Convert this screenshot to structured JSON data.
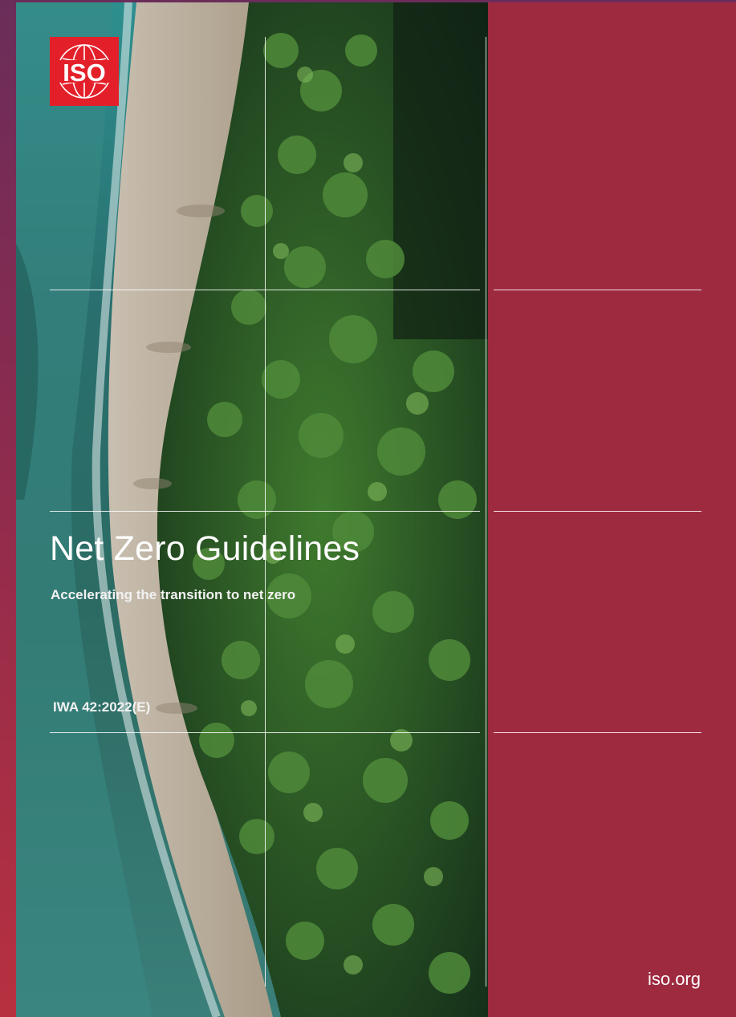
{
  "cover": {
    "logo_text": "ISO",
    "title": "Net Zero Guidelines",
    "subtitle": "Accelerating the transition to net zero",
    "document_number": "IWA 42:2022(E)",
    "website": "iso.org"
  },
  "colors": {
    "panel": "#9e2a40",
    "logo_red": "#e3202a",
    "text": "#ffffff"
  },
  "icons": {
    "logo": "iso-globe-logo-icon",
    "photo": "aerial-beach-palm-forest-image"
  }
}
